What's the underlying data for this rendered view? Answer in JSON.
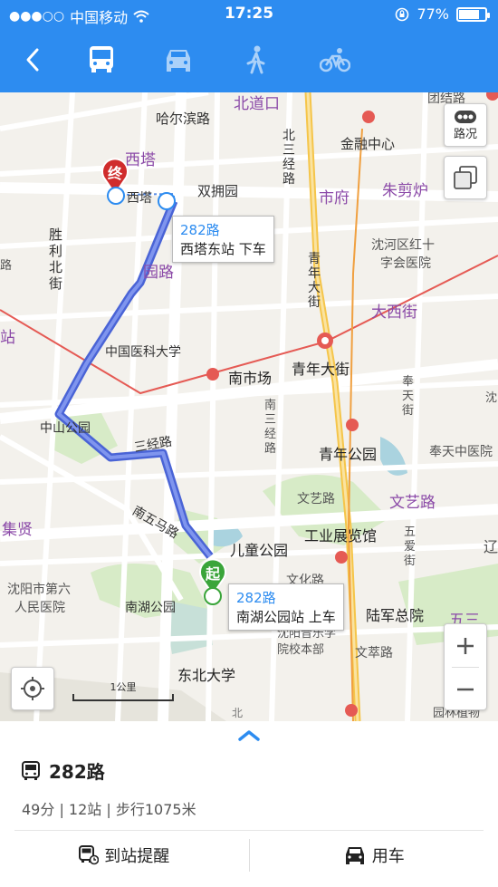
{
  "status": {
    "carrier": "中国移动",
    "time": "17:25",
    "battery": "77%",
    "battery_fraction": 0.77
  },
  "modes": [
    {
      "icon": "back-chevron-icon"
    },
    {
      "icon": "bus-icon",
      "active": true
    },
    {
      "icon": "car-icon"
    },
    {
      "icon": "walk-icon"
    },
    {
      "icon": "bike-icon"
    }
  ],
  "map": {
    "traffic_label": "路况",
    "scale_label": "1公里",
    "end_marker": "终",
    "start_marker": "起",
    "end_callout": {
      "route": "282路",
      "stop": "西塔东站 下车"
    },
    "start_callout": {
      "route": "282路",
      "stop": "南湖公园站 上车"
    },
    "labels": {
      "beidaokou": "北道口",
      "huaerbin": "哈尔滨路",
      "jinrongzhongxin": "金融中心",
      "xita": "西塔",
      "xita_station": "西塔",
      "shuangyongyuan": "双拥园",
      "shifu": "市府",
      "zhujianlu": "朱剪炉",
      "beisanjinglu": "北三经路",
      "shenghe_hospital_1": "沈河区红十",
      "shenghe_hospital_2": "字会医院",
      "shengli_beijie": "胜利北街",
      "yuanlu": "园路",
      "qingnian_dajie_v": "青年大街",
      "daxijie": "大西街",
      "yike_daxue": "中国医科大学",
      "nanshichang": "南市场",
      "qingnian_dajie": "青年大街",
      "zhongshan_park": "中山公园",
      "nansanjing": "南三经路",
      "fengtianjie": "奉天街",
      "sanjinglu": "三经路",
      "qingnian_park": "青年公园",
      "fengtian_hospital": "奉天中医院",
      "jixian": "集贤",
      "wenyilu": "文艺路",
      "wenyilu_big": "文艺路",
      "nanwumalu": "南五马路",
      "gongye": "工业展览馆",
      "wuailu": "五爱街",
      "ertong_park": "儿童公园",
      "shenyang_hospital_1": "沈阳市第六",
      "shenyang_hospital_2": "人民医院",
      "nanhu_park": "南湖公园",
      "wenhualu": "文化路",
      "lujun": "陆军总院",
      "conservatory_1": "沈阳音乐学",
      "conservatory_2": "院校本部",
      "wencuilu": "文萃路",
      "wusan": "五三",
      "dongbei_daxue": "东北大学",
      "yuanlin": "园林植物",
      "tuanjielu": "团结路",
      "zhan": "站",
      "lu": "路",
      "shen": "沈",
      "liao": "辽",
      "bei": "北"
    }
  },
  "route": {
    "name": "282路",
    "meta": "49分 | 12站 | 步行1075米"
  },
  "actions": {
    "remind": "到站提醒",
    "car": "用车"
  }
}
